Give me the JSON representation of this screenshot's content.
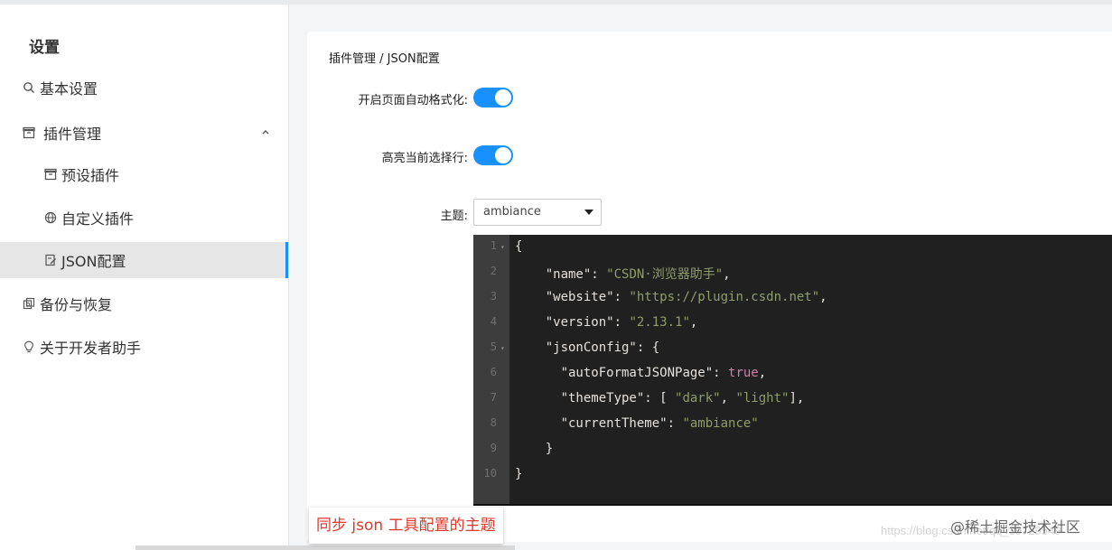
{
  "sidebar": {
    "title": "设置",
    "items": [
      {
        "label": "基本设置",
        "icon": "search-icon"
      },
      {
        "label": "插件管理",
        "icon": "box-icon",
        "expanded": true
      },
      {
        "label": "预设插件",
        "icon": "box-icon"
      },
      {
        "label": "自定义插件",
        "icon": "globe-icon"
      },
      {
        "label": "JSON配置",
        "icon": "file-edit-icon",
        "active": true
      },
      {
        "label": "备份与恢复",
        "icon": "copy-icon"
      },
      {
        "label": "关于开发者助手",
        "icon": "bulb-icon"
      }
    ]
  },
  "breadcrumb": "插件管理 / JSON配置",
  "form": {
    "auto_format_label": "开启页面自动格式化:",
    "auto_format_value": true,
    "highlight_label": "高亮当前选择行:",
    "highlight_value": true,
    "theme_label": "主题:",
    "theme_value": "ambiance"
  },
  "editor": {
    "lines": [
      {
        "n": "1",
        "fold": true
      },
      {
        "n": "2"
      },
      {
        "n": "3"
      },
      {
        "n": "4"
      },
      {
        "n": "5",
        "fold": true
      },
      {
        "n": "6"
      },
      {
        "n": "7"
      },
      {
        "n": "8"
      },
      {
        "n": "9"
      },
      {
        "n": "10"
      }
    ],
    "tokens": {
      "name_key": "\"name\"",
      "name_val": "\"CSDN·浏览器助手\"",
      "website_key": "\"website\"",
      "website_val": "\"https://plugin.csdn.net\"",
      "version_key": "\"version\"",
      "version_val": "\"2.13.1\"",
      "jsonconfig_key": "\"jsonConfig\"",
      "autoformat_key": "\"autoFormatJSONPage\"",
      "autoformat_val": "true",
      "themetype_key": "\"themeType\"",
      "themetype_v1": "\"dark\"",
      "themetype_v2": "\"light\"",
      "currenttheme_key": "\"currentTheme\"",
      "currenttheme_val": "\"ambiance\""
    }
  },
  "caption": "同步 json 工具配置的主题",
  "watermark": {
    "url": "https://blog.csdn.net/qq_39729549",
    "site": "@稀土掘金技术社区"
  },
  "colors": {
    "accent": "#1890ff",
    "editor_bg": "#202020",
    "caption_text": "#e0392b"
  }
}
